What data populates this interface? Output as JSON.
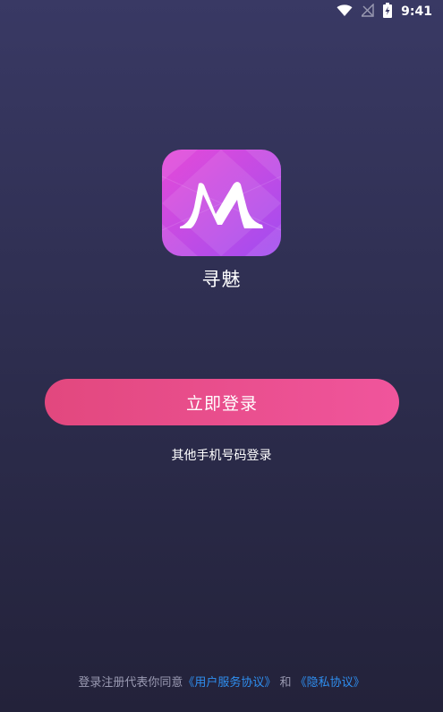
{
  "status_bar": {
    "time": "9:41",
    "icons": [
      "wifi-icon",
      "no-signal-icon",
      "battery-charging-icon"
    ]
  },
  "app": {
    "logo_letter": "M",
    "name": "寻魅"
  },
  "login": {
    "primary_button": "立即登录",
    "other_phone_login": "其他手机号码登录"
  },
  "agreement": {
    "prefix": "登录注册代表你同意",
    "user_agreement": "《用户服务协议》",
    "conjunction": "和",
    "privacy_policy": "《隐私协议》"
  },
  "colors": {
    "background_top": "#393964",
    "background_bottom": "#23223a",
    "button_start": "#e2487e",
    "button_end": "#f0559c",
    "link": "#2f8ff0",
    "logo_start": "#e54ad8",
    "logo_end": "#a14df0"
  }
}
